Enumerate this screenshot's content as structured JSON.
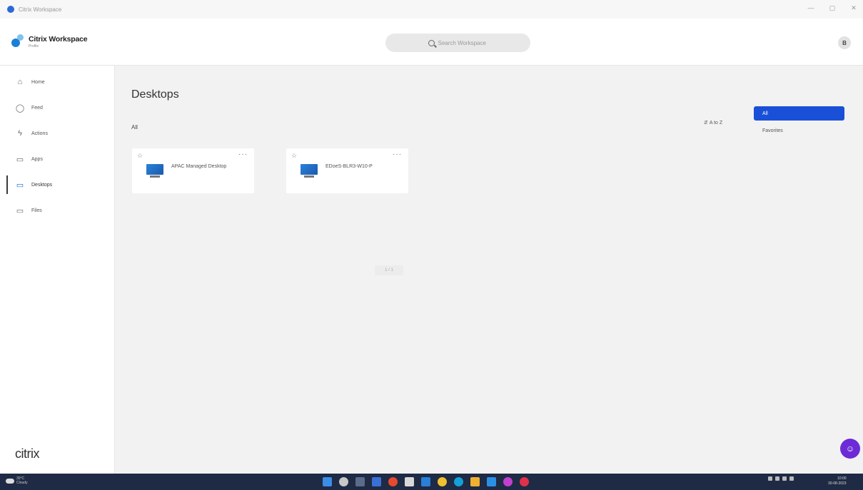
{
  "window": {
    "title": "Citrix Workspace",
    "controls": [
      "—",
      "▢",
      "✕"
    ]
  },
  "header": {
    "logo_name": "Citrix Workspace",
    "logo_sub": "Profile",
    "search_placeholder": "Search Workspace",
    "avatar_initials": "B"
  },
  "sidebar": {
    "items": [
      {
        "label": "Home",
        "icon": "home-icon",
        "glyph": "⌂"
      },
      {
        "label": "Feed",
        "icon": "bell-icon",
        "glyph": "◯"
      },
      {
        "label": "Actions",
        "icon": "bolt-icon",
        "glyph": "ϟ"
      },
      {
        "label": "Apps",
        "icon": "apps-icon",
        "glyph": "▭"
      },
      {
        "label": "Desktops",
        "icon": "desktop-icon",
        "glyph": "▭"
      },
      {
        "label": "Files",
        "icon": "folder-icon",
        "glyph": "▭"
      }
    ],
    "active": "Desktops",
    "brand": "citrix"
  },
  "main": {
    "title": "Desktops",
    "section_label": "All",
    "sort_label": "A to Z",
    "filters": {
      "all": "All",
      "favorites": "Favorites"
    },
    "cards": [
      {
        "name": "APAC Managed Desktop",
        "star": "☆",
        "more": "···"
      },
      {
        "name": "EDoeS-BLR3-W10-P",
        "star": "☆",
        "more": "···"
      }
    ],
    "pager": "1 / 1"
  },
  "taskbar": {
    "weather_temp": "30°C",
    "weather_desc": "Cloudy",
    "time": "10:00",
    "date": "30-08-2023",
    "accent": "#1f2a44"
  },
  "colors": {
    "primary": "#1a4fd8",
    "fab": "#6c2bd6",
    "background": "#f2f2f2"
  }
}
